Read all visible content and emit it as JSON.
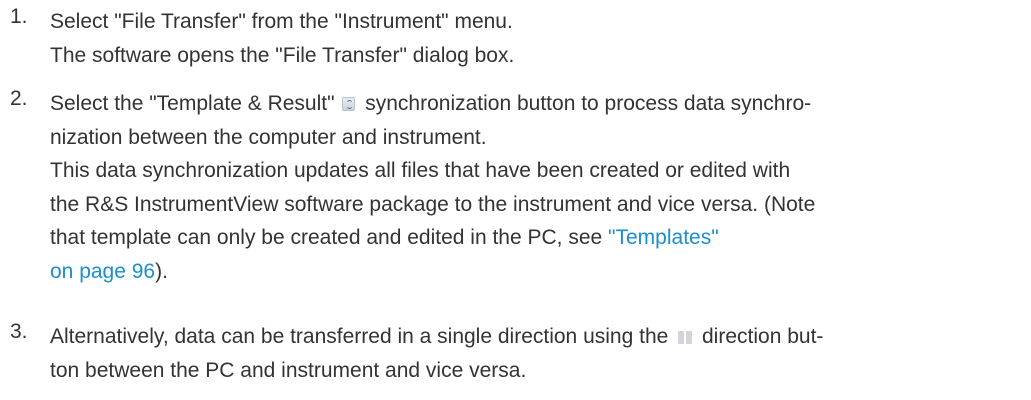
{
  "steps": [
    {
      "number": "1.",
      "lines": [
        "Select \"File Transfer\" from the \"Instrument\" menu.",
        "The software opens the \"File Transfer\" dialog box."
      ]
    },
    {
      "number": "2.",
      "line1_before": "Select the \"Template & Result\"",
      "line1_icon": "sync-icon",
      "line1_after": "synchronization button to process data synchro-",
      "lines": [
        "nization between the computer and instrument.",
        "This data synchronization updates all files that have been created or edited with",
        "the R&S InstrumentView software package to the instrument and vice versa. (Note"
      ],
      "line5_before": "that template can only be created and edited in the PC, see",
      "line5_link": "\"Templates\"",
      "line6_link": "on page 96",
      "line6_after": ")."
    },
    {
      "number": "3.",
      "line1_before": "Alternatively, data can be transferred in a single direction using the",
      "line1_icon": "direction-icon",
      "line1_after": "direction but-",
      "line2": "ton between the PC and instrument and vice versa."
    }
  ],
  "colors": {
    "text": "#333333",
    "link": "#1a8fcf"
  }
}
